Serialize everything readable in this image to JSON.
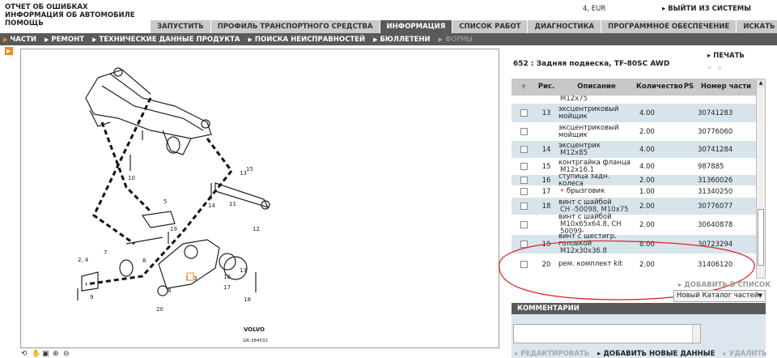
{
  "top_links": [
    "ОТЧЕТ ОБ ОШИБКАХ",
    "ИНФОРМАЦИЯ ОБ АВТОМОБИЛЕ",
    "ПОМОЩЬ"
  ],
  "currency": "4, EUR",
  "logout_label": "ВЫЙТИ ИЗ СИСТЕМЫ",
  "tabs": [
    {
      "label": "ЗАПУСТИТЬ",
      "active": false
    },
    {
      "label": "ПРОФИЛЬ ТРАНСПОРТНОГО СРЕДСТВА",
      "active": false
    },
    {
      "label": "ИНФОРМАЦИЯ",
      "active": true
    },
    {
      "label": "СПИСОК РАБОТ",
      "active": false
    },
    {
      "label": "ДИАГНОСТИКА",
      "active": false
    },
    {
      "label": "ПРОГРАММНОЕ ОБЕСПЕЧЕНИЕ",
      "active": false
    },
    {
      "label": "ИСКАТЬ",
      "active": false
    }
  ],
  "subnav": [
    {
      "label": "ЧАСТИ",
      "state": "active"
    },
    {
      "label": "РЕМОНТ",
      "state": "normal"
    },
    {
      "label": "ТЕХНИЧЕСКИЕ ДАННЫЕ ПРОДУКТА",
      "state": "normal"
    },
    {
      "label": "ПОИСКА НЕИСПРАВНОСТЕЙ",
      "state": "normal"
    },
    {
      "label": "БЮЛЛЕТЕНИ",
      "state": "normal"
    },
    {
      "label": "ФОРМЫ",
      "state": "dim"
    }
  ],
  "diagram": {
    "brand": "VOLVO",
    "ref": "GR-384532",
    "callouts": [
      "10",
      "13",
      "15",
      "14",
      "11",
      "5",
      "12",
      "19",
      "7",
      "6",
      "8",
      "16",
      "2, 4",
      "9",
      "1",
      "3",
      "18",
      "20",
      "17",
      "13"
    ]
  },
  "panel": {
    "title": "652 : Задняя подвеска, TF-80SC AWD",
    "print_label": "ПЕЧАТЬ",
    "columns": [
      "Рис.",
      "Описание",
      "Количество",
      "PS",
      "Номер части"
    ],
    "rows": [
      {
        "fig": "",
        "desc": "",
        "sub": "M12x75",
        "qty": "",
        "part": "",
        "cb": false,
        "alt": false
      },
      {
        "fig": "13",
        "desc": "эксцентриковый мойщик",
        "sub": "",
        "qty": "4.00",
        "part": "30741283",
        "cb": true,
        "alt": true
      },
      {
        "fig": "",
        "desc": "эксцентриковый мойщик",
        "sub": "",
        "qty": "2.00",
        "part": "30776060",
        "cb": true,
        "alt": false
      },
      {
        "fig": "14",
        "desc": "эксцентрик",
        "sub": "M12x85",
        "qty": "4.00",
        "part": "30741284",
        "cb": true,
        "alt": true
      },
      {
        "fig": "15",
        "desc": "контргайка фланца",
        "sub": "M12x16.1",
        "qty": "4.00",
        "part": "987885",
        "cb": true,
        "alt": false
      },
      {
        "fig": "16",
        "desc": "ступица задн. колеса",
        "sub": "",
        "qty": "2.00",
        "part": "31360026",
        "cb": true,
        "alt": true
      },
      {
        "fig": "17",
        "desc": "брызговик",
        "sub": "",
        "qty": "1.00",
        "part": "31340250",
        "cb": true,
        "alt": false
      },
      {
        "fig": "18",
        "desc": "винт с шайбой",
        "sub": "CH -50098, M10x75",
        "qty": "2.00",
        "part": "30776077",
        "cb": true,
        "alt": true
      },
      {
        "fig": "",
        "desc": "винт с шайбой",
        "sub": "M10x65x64.8, CH 50099-",
        "qty": "2.00",
        "part": "30640878",
        "cb": true,
        "alt": false
      },
      {
        "fig": "19",
        "desc": "винт с шестигр. головкой",
        "sub": "M12x30x36.8",
        "qty": "8.00",
        "part": "30723294",
        "cb": true,
        "alt": true
      },
      {
        "fig": "20",
        "desc": "рем. комплект kit",
        "sub": "",
        "qty": "2.00",
        "part": "31406120",
        "cb": true,
        "alt": false
      }
    ],
    "add_to_list_label": "ДОБАВИТЬ В СПИСОК",
    "catalog_select": "Новый Каталог частей"
  },
  "comments": {
    "header": "КОММЕНТАРИИ",
    "edit_label": "РЕДАКТИРОВАТЬ",
    "add_label": "ДОБАВИТЬ НОВЫЕ ДАННЫЕ",
    "delete_label": "УДАЛИТЬ"
  },
  "colors": {
    "tab_bar": "#5a5a5a",
    "accent": "#f08a1a",
    "row_alt": "#d8e4ec",
    "annotation": "#e02020"
  }
}
